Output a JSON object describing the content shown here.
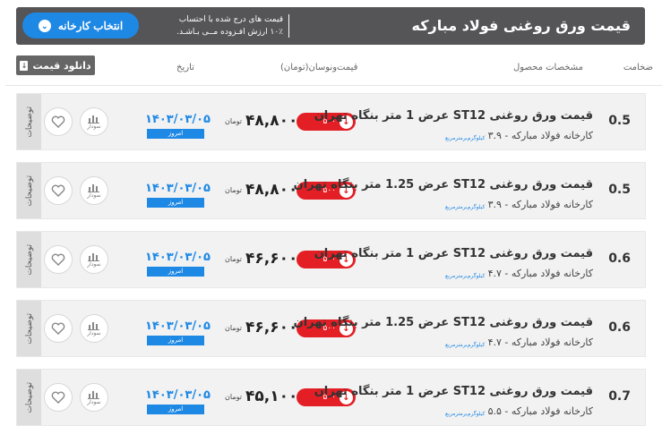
{
  "header": {
    "title": "قیمت ورق روغنی فولاد مبارکه",
    "note_line1": "قیمت های درج شده با احتساب",
    "note_line2": "۱۰٪ ارزش افـزوده مــی بـاشـد.",
    "select_label": "انتخاب کارخانه"
  },
  "toolbar": {
    "download_label": "دانلود قیمت"
  },
  "columns": {
    "thickness": "ضخامت",
    "specs": "مشخصات محصول",
    "price": "قیمت‌ونوسان(تومان)",
    "date": "تاریخ"
  },
  "row_common": {
    "unit": "تومان",
    "today": "امروز",
    "chart_label": "نمودار",
    "details_label": "توضیحات",
    "change_value": "۵۰۰",
    "weight_label": "کیلوگرم‌بر‌مترمربع"
  },
  "rows": [
    {
      "name": "قیمت ورق روغنی ST12 عرض 1 متر بنگاه تهران",
      "factory": "کارخانه فولاد مبارکه",
      "weight": "۳.۹",
      "price": "۴۸,۸۰۰",
      "date": "۱۴۰۳/۰۳/۰۵",
      "thickness": "0.5"
    },
    {
      "name": "قیمت ورق روغنی ST12 عرض 1.25 متر بنگاه تهران",
      "factory": "کارخانه فولاد مبارکه",
      "weight": "۳.۹",
      "price": "۴۸,۸۰۰",
      "date": "۱۴۰۳/۰۳/۰۵",
      "thickness": "0.5"
    },
    {
      "name": "قیمت ورق روغنی ST12 عرض 1 متر بنگاه تهران",
      "factory": "کارخانه فولاد مبارکه",
      "weight": "۴.۷",
      "price": "۴۶,۶۰۰",
      "date": "۱۴۰۳/۰۳/۰۵",
      "thickness": "0.6"
    },
    {
      "name": "قیمت ورق روغنی ST12 عرض 1.25 متر بنگاه تهران",
      "factory": "کارخانه فولاد مبارکه",
      "weight": "۴.۷",
      "price": "۴۶,۶۰۰",
      "date": "۱۴۰۳/۰۳/۰۵",
      "thickness": "0.6"
    },
    {
      "name": "قیمت ورق روغنی ST12 عرض 1 متر بنگاه تهران",
      "factory": "کارخانه فولاد مبارکه",
      "weight": "۵.۵",
      "price": "۴۵,۱۰۰",
      "date": "۱۴۰۳/۰۳/۰۵",
      "thickness": "0.7"
    }
  ]
}
